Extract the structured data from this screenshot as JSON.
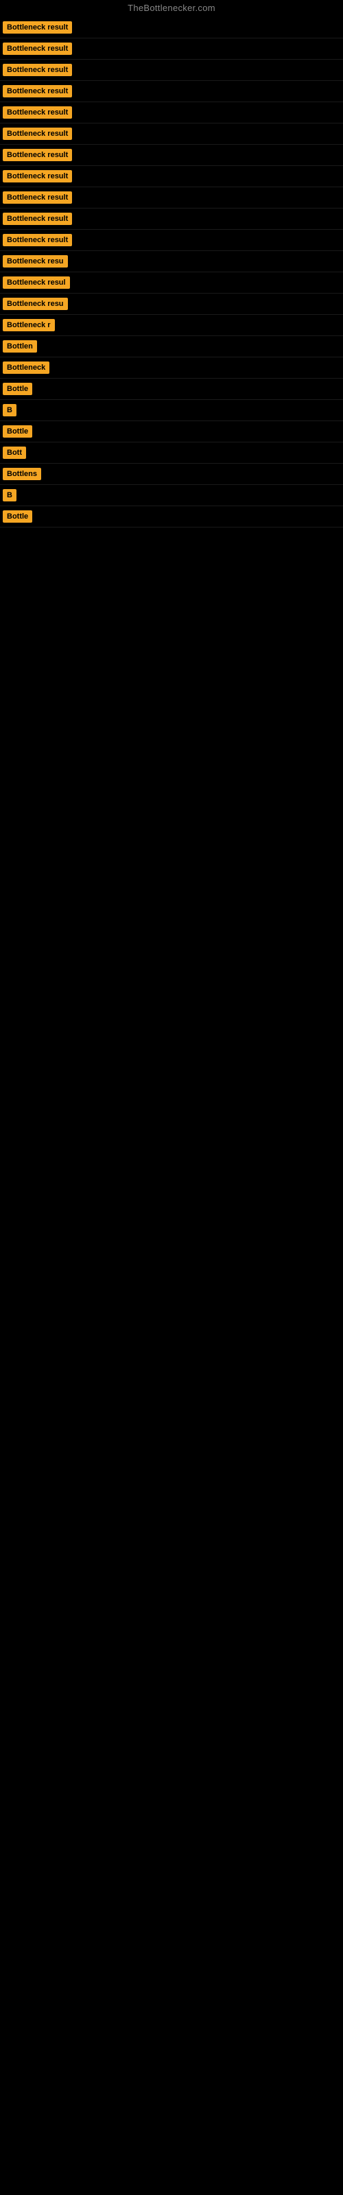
{
  "site": {
    "title": "TheBottlenecker.com"
  },
  "results": [
    {
      "id": 1,
      "label": "Bottleneck result",
      "visible_chars": 16
    },
    {
      "id": 2,
      "label": "Bottleneck result",
      "visible_chars": 16
    },
    {
      "id": 3,
      "label": "Bottleneck result",
      "visible_chars": 16
    },
    {
      "id": 4,
      "label": "Bottleneck result",
      "visible_chars": 16
    },
    {
      "id": 5,
      "label": "Bottleneck result",
      "visible_chars": 16
    },
    {
      "id": 6,
      "label": "Bottleneck result",
      "visible_chars": 16
    },
    {
      "id": 7,
      "label": "Bottleneck result",
      "visible_chars": 16
    },
    {
      "id": 8,
      "label": "Bottleneck result",
      "visible_chars": 16
    },
    {
      "id": 9,
      "label": "Bottleneck result",
      "visible_chars": 16
    },
    {
      "id": 10,
      "label": "Bottleneck result",
      "visible_chars": 16
    },
    {
      "id": 11,
      "label": "Bottleneck result",
      "visible_chars": 16
    },
    {
      "id": 12,
      "label": "Bottleneck resu",
      "visible_chars": 15
    },
    {
      "id": 13,
      "label": "Bottleneck resul",
      "visible_chars": 16
    },
    {
      "id": 14,
      "label": "Bottleneck resu",
      "visible_chars": 15
    },
    {
      "id": 15,
      "label": "Bottleneck r",
      "visible_chars": 12
    },
    {
      "id": 16,
      "label": "Bottlen",
      "visible_chars": 7
    },
    {
      "id": 17,
      "label": "Bottleneck",
      "visible_chars": 10
    },
    {
      "id": 18,
      "label": "Bottle",
      "visible_chars": 6
    },
    {
      "id": 19,
      "label": "B",
      "visible_chars": 1
    },
    {
      "id": 20,
      "label": "Bottle",
      "visible_chars": 6
    },
    {
      "id": 21,
      "label": "Bott",
      "visible_chars": 4
    },
    {
      "id": 22,
      "label": "Bottlens",
      "visible_chars": 8
    },
    {
      "id": 23,
      "label": "B",
      "visible_chars": 1
    },
    {
      "id": 24,
      "label": "Bottle",
      "visible_chars": 6
    }
  ]
}
